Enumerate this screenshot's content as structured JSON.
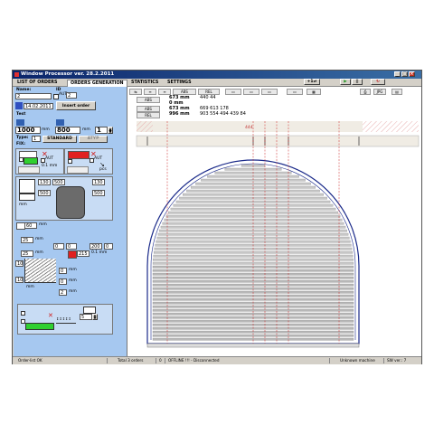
{
  "window": {
    "title": "Window Processor   ver.  28.2.2011"
  },
  "tabs": [
    "LIST OF ORDERS",
    "ORDERS GENERATION",
    "STATISTICS",
    "SETTINGS"
  ],
  "toolbar_right": {
    "counter": "+1"
  },
  "left": {
    "name_label": "Name:",
    "name_value": "2",
    "id_label": "ID",
    "id_value": "2",
    "aut_label": "AUT",
    "date": "14.02.2011",
    "insert_order": "Insert order",
    "test_label": "Test",
    "width_value": "1000",
    "width_unit": "mm",
    "height_value": "800",
    "height_unit": "mm",
    "qty_value": "1",
    "type_label": "Type:",
    "type_value": "1",
    "type_std": "STANDARD",
    "type_atyp": "ATYP",
    "fix_label": "FIX:",
    "aut1": "AUT",
    "aut2": "AUT",
    "mm_small": "0.1 mm",
    "pcs": "pcs",
    "g_130a": "130",
    "g_500a": "500",
    "g_130b": "130",
    "g_500b": "500",
    "g_500c": "500",
    "g_mm": "mm",
    "v60": "60",
    "v_mm60": "mm",
    "v25a": "25",
    "v_mm25": "mm",
    "r0a": "0",
    "r0b": "0",
    "r200": "200",
    "r0c": "0",
    "v25b": "25",
    "v_mm25b": "mm",
    "v215": "215",
    "v_mm215": "0.1 mm",
    "v10a": "10",
    "v0a": "0",
    "v_mma": "mm",
    "v10b": "10",
    "v0b": "0",
    "v_mmb": "mm",
    "v_mmc": "mm",
    "v2": "2",
    "v_mmd": "mm",
    "stack_value": "5"
  },
  "main": {
    "row1": {
      "abs": "ABS",
      "rel": "REL",
      "jpg": "JPG"
    },
    "row2": {
      "abs_label": "ABS",
      "v1": "673 mm",
      "nums1": "440  44"
    },
    "row3": {
      "v2": "0 mm"
    },
    "row4": {
      "abs_label": "ABS",
      "v3": "673 mm",
      "nums3": "669  613  178"
    },
    "row5": {
      "rel_label": "REL",
      "v4": "996 mm",
      "nums4": "903  554  494  439  84"
    },
    "ruler_label": "444"
  },
  "status": {
    "s1": "Order-list OK",
    "s2": "Total 3 orders",
    "s3": "0",
    "s4": "OFFLINE !!! - Disconnected",
    "s5": "Unknown machine",
    "s6": "SW ver.: 7"
  },
  "colors": {
    "title": "#0a246a",
    "panel": "#a6c8f0",
    "arch": "#1a2a8a",
    "redline": "#cc2222"
  }
}
